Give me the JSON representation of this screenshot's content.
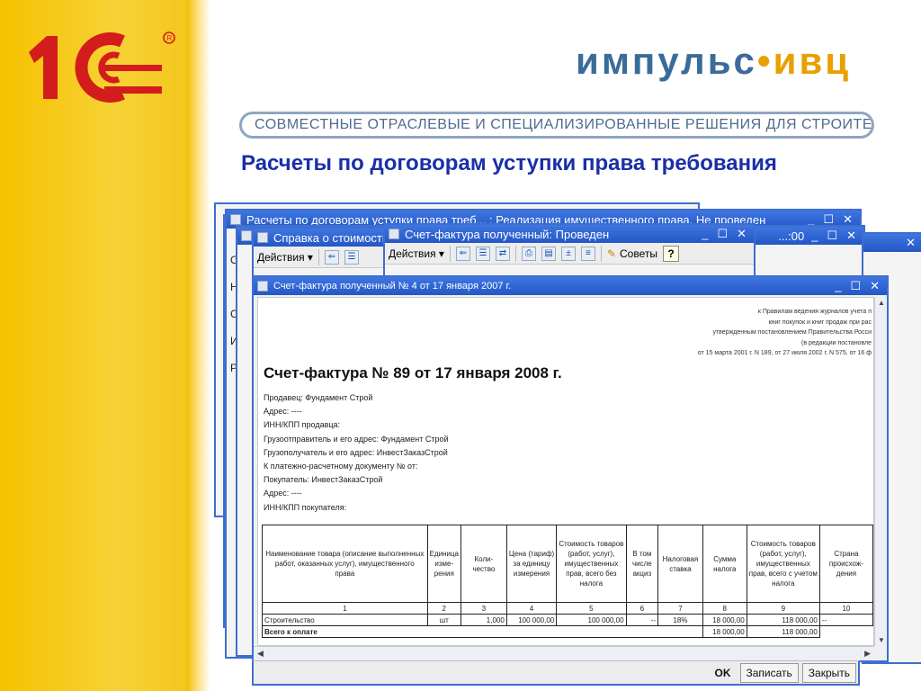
{
  "branding": {
    "logo_1c": "1С",
    "company_a": "импульс",
    "company_dot": "•",
    "company_b": "ивц",
    "tagline": "СОВМЕСТНЫЕ ОТРАСЛЕВЫЕ И СПЕЦИАЛИЗИРОВАННЫЕ РЕШЕНИЯ ДЛЯ СТРОИТЕЛЬСТВА"
  },
  "slide": {
    "title": "Расчеты по договорам уступки права требования"
  },
  "windows": {
    "back1": {
      "title": "Расчеты по договорам уступки права треб... : Реализация имущественного права. Не проведен",
      "controls": [
        "_",
        "☐",
        "✕"
      ]
    },
    "mid": {
      "title": "...:00",
      "controls": [
        "_",
        "☐",
        "✕"
      ],
      "close": "✕"
    },
    "spravka": {
      "title": "Справка о стоимости",
      "actions_label": "Действия ▾"
    },
    "invoice_received": {
      "title": "Счет-фактура полученный: Проведен",
      "controls": [
        "_",
        "☐",
        "✕"
      ],
      "actions_label": "Действия ▾",
      "tips_label": "Советы",
      "help_label": "?"
    },
    "side_letters": [
      "О",
      "Н",
      "С",
      "И",
      "Р"
    ],
    "print": {
      "title": "Счет-фактура полученный № 4 от 17 января 2007 г.",
      "controls": [
        "_",
        "☐",
        "✕"
      ],
      "legal_lines": [
        "к Правилам ведения журналов учета п",
        "книг покупок и книг продаж при рас",
        "утвержденным постановлением Правительства Росси",
        "(в редакции постановле",
        "от 15 марта 2001 г. N 189, от 27 июля 2002 г. N 575, от 16 ф"
      ],
      "invoice_title": "Счет-фактура № 89 от 17 января 2008 г.",
      "fields": [
        "Продавец: Фундамент Строй",
        "Адрес: ----",
        "ИНН/КПП продавца:",
        "Грузоотправитель и его адрес: Фундамент Строй",
        "Грузополучатель и его адрес: ИнвестЗаказСтрой",
        "К платежно-расчетному документу № от:",
        "Покупатель: ИнвестЗаказСтрой",
        "Адрес: ----",
        "ИНН/КПП покупателя:"
      ],
      "table": {
        "headers": [
          "Наименование товара (описание выполненных работ, оказанных услуг), имущественного права",
          "Единица изме- рения",
          "Коли- чество",
          "Цена (тариф) за единицу измерения",
          "Стоимость товаров (работ, услуг), имущественных прав, всего без налога",
          "В том числе акциз",
          "Налоговая ставка",
          "Сумма налога",
          "Стоимость товаров (работ, услуг), имущественных прав, всего с учетом налога",
          "Страна происхож- дения"
        ],
        "column_numbers": [
          "1",
          "2",
          "3",
          "4",
          "5",
          "6",
          "7",
          "8",
          "9",
          "10"
        ],
        "row": {
          "name": "Строительство",
          "unit": "шт",
          "qty": "1,000",
          "price": "100 000,00",
          "cost": "100 000,00",
          "excise": "--",
          "rate": "18%",
          "tax": "18 000,00",
          "total": "118 000,00",
          "country": "--"
        },
        "total_row": {
          "label": "Всего к оплате",
          "tax": "18 000,00",
          "total": "118 000,00"
        }
      }
    },
    "bottom_buttons": {
      "ok": "OK",
      "save": "Записать",
      "close": "Закрыть"
    }
  }
}
